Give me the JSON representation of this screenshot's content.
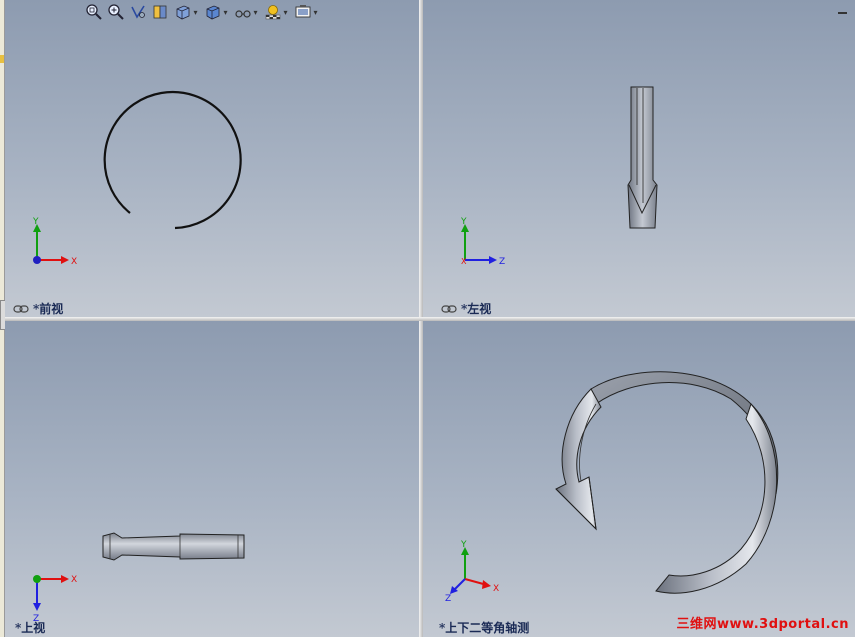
{
  "viewports": {
    "front": {
      "label": "*前视",
      "axes": {
        "up": "Y",
        "right": "X"
      }
    },
    "left": {
      "label": "*左视",
      "axes": {
        "up": "Y",
        "right": "Z",
        "origin": "X"
      }
    },
    "top": {
      "label": "*上视",
      "axes": {
        "down": "Z",
        "right": "X"
      }
    },
    "iso": {
      "label": "*上下二等角轴测",
      "axes": {
        "up": "Y",
        "right": "X",
        "down": "Z"
      }
    }
  },
  "toolbar": {
    "icons": [
      "zoom-fit-icon",
      "zoom-area-icon",
      "rotate-view-icon",
      "section-view-icon",
      "view-orientation-icon",
      "display-style-icon",
      "hide-show-icon",
      "appearance-icon",
      "scene-icon"
    ]
  },
  "watermark": "三维网www.3dportal.cn",
  "colors": {
    "x_axis": "#e01010",
    "y_axis": "#10a010",
    "z_axis": "#2020e0",
    "label": "#1a2a55",
    "watermark": "#e01010"
  }
}
